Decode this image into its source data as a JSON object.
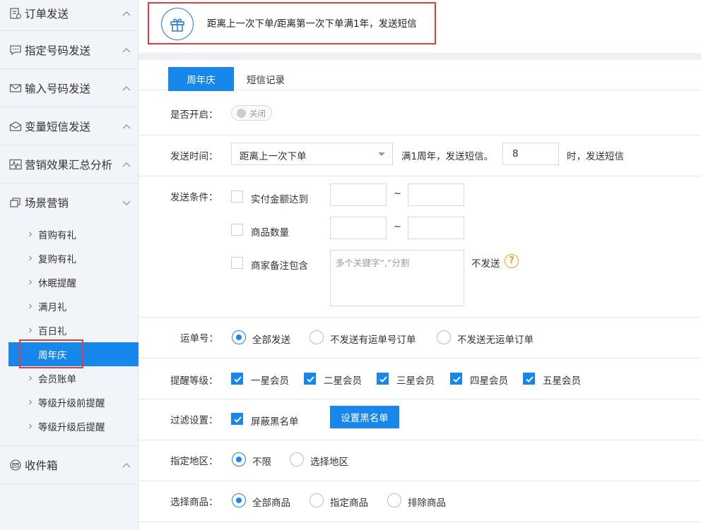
{
  "sidebar": {
    "groups": [
      {
        "label": "订单发送",
        "icon": "order-icon"
      },
      {
        "label": "指定号码发送",
        "icon": "chat-icon"
      },
      {
        "label": "输入号码发送",
        "icon": "mail-icon"
      },
      {
        "label": "变量短信发送",
        "icon": "envelope-open-icon"
      },
      {
        "label": "营销效果汇总分析",
        "icon": "pulse-icon"
      },
      {
        "label": "场景营销",
        "icon": "stack-icon"
      }
    ],
    "items": [
      "首购有礼",
      "复购有礼",
      "休眠提醒",
      "满月礼",
      "百日礼",
      "周年庆",
      "会员账单",
      "等级升级前提醒",
      "等级升级后提醒"
    ],
    "active_item": "周年庆",
    "inbox": {
      "label": "收件箱",
      "icon": "inbox-icon"
    }
  },
  "banner": {
    "icon": "gift-icon",
    "text": "距离上一次下单/距离第一次下单满1年，发送短信"
  },
  "tabs": [
    {
      "label": "周年庆",
      "active": true
    },
    {
      "label": "短信记录",
      "active": false
    }
  ],
  "form": {
    "enable": {
      "label": "是否开启：",
      "toggle_text": "关闭",
      "on": false
    },
    "send_time": {
      "label": "发送时间：",
      "select_value": "距离上一次下单",
      "text_after_select": "满1周年，发送短信。",
      "hour_value": "8",
      "text_after_hour": "时，发送短信"
    },
    "conditions": {
      "label": "发送条件：",
      "amount_label": "实付金额达到",
      "quantity_label": "商品数量",
      "remark_label": "商家备注包含",
      "remark_placeholder": "多个关键字“,”分割",
      "remark_suffix": "不发送",
      "range_sep": "~",
      "help_icon": "?"
    },
    "tracking": {
      "label": "运单号：",
      "options": [
        "全部发送",
        "不发送有运单号订单",
        "不发送无运单订单"
      ],
      "selected": 0
    },
    "level": {
      "label": "提醒等级：",
      "options": [
        "一星会员",
        "二星会员",
        "三星会员",
        "四星会员",
        "五星会员"
      ]
    },
    "filter": {
      "label": "过滤设置：",
      "checkbox_label": "屏蔽黑名单",
      "button": "设置黑名单"
    },
    "region": {
      "label": "指定地区：",
      "options": [
        "不限",
        "选择地区"
      ],
      "selected": 0
    },
    "goods": {
      "label": "选择商品：",
      "options": [
        "全部商品",
        "指定商品",
        "排除商品"
      ],
      "selected": 0
    }
  },
  "colors": {
    "accent": "#1787ec",
    "highlight": "#e23c3c",
    "help": "#f0a11a"
  }
}
